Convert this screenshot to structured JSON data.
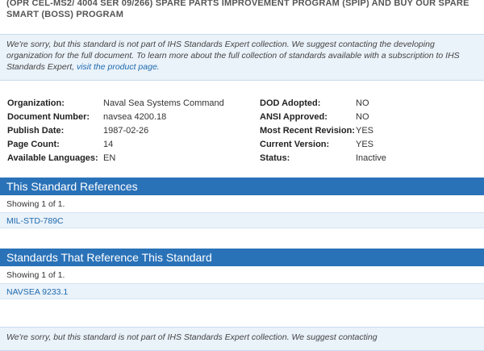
{
  "title": "(OPR CEL-MS2/ 4004 SER 09/266) SPARE PARTS IMPROVEMENT PROGRAM (SPIP) AND BUY OUR SPARE SMART (BOSS) PROGRAM",
  "notice": {
    "text": "We're sorry, but this standard is not part of IHS Standards Expert collection. We suggest contacting the developing organization for the full document. To learn more about the full collection of standards available with a subscription to IHS Standards Expert,",
    "link_text": "visit the product page."
  },
  "details": {
    "left": [
      {
        "label": "Organization:",
        "value": "Naval Sea Systems Command"
      },
      {
        "label": "Document Number:",
        "value": "navsea 4200.18"
      },
      {
        "label": "Publish Date:",
        "value": "1987-02-26"
      },
      {
        "label": "Page Count:",
        "value": "14"
      },
      {
        "label": "Available Languages:",
        "value": "EN"
      }
    ],
    "right": [
      {
        "label": "DOD Adopted:",
        "value": "NO"
      },
      {
        "label": "ANSI Approved:",
        "value": "NO"
      },
      {
        "label": "Most Recent Revision:",
        "value": "YES"
      },
      {
        "label": "Current Version:",
        "value": "YES"
      },
      {
        "label": "Status:",
        "value": "Inactive"
      }
    ]
  },
  "references": {
    "header": "This Standard References",
    "showing": "Showing 1 of 1.",
    "items": [
      "MIL-STD-789C"
    ]
  },
  "referenced_by": {
    "header": "Standards That Reference This Standard",
    "showing": "Showing 1 of 1.",
    "items": [
      "NAVSEA 9233.1"
    ]
  },
  "bottom_notice": {
    "text": "We're sorry, but this standard is not part of IHS Standards Expert collection. We suggest contacting"
  },
  "colors": {
    "header_bg": "#2a72b8",
    "notice_bg": "#eaf2fa",
    "link": "#1e6aae"
  }
}
